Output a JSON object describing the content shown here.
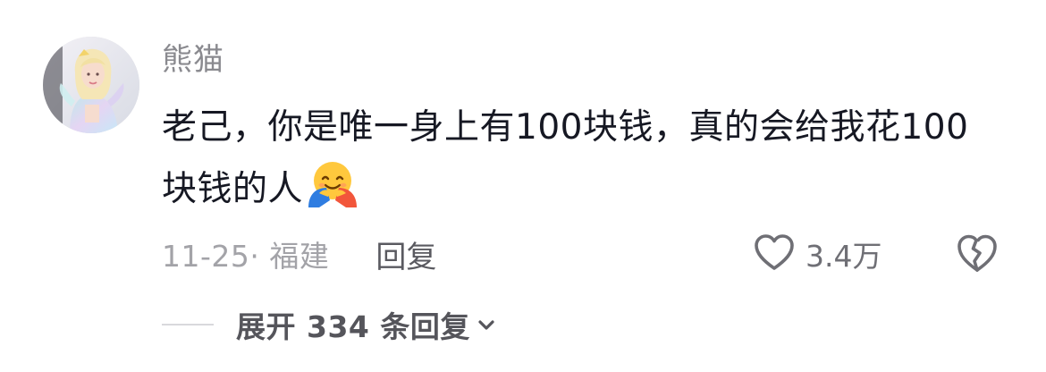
{
  "comment": {
    "username": "熊猫",
    "text": "老己，你是唯一身上有100块钱，真的会给我花100块钱的人",
    "emoji": "hugging-face",
    "meta": {
      "date_location": "11-25· 福建",
      "reply_label": "回复",
      "like_count": "3.4万"
    },
    "expand_label": "展开 334 条回复"
  },
  "colors": {
    "text_primary": "#161823",
    "text_secondary": "#8a8a8f",
    "text_muted": "#a3a3a8",
    "icon": "#6f6f75"
  }
}
